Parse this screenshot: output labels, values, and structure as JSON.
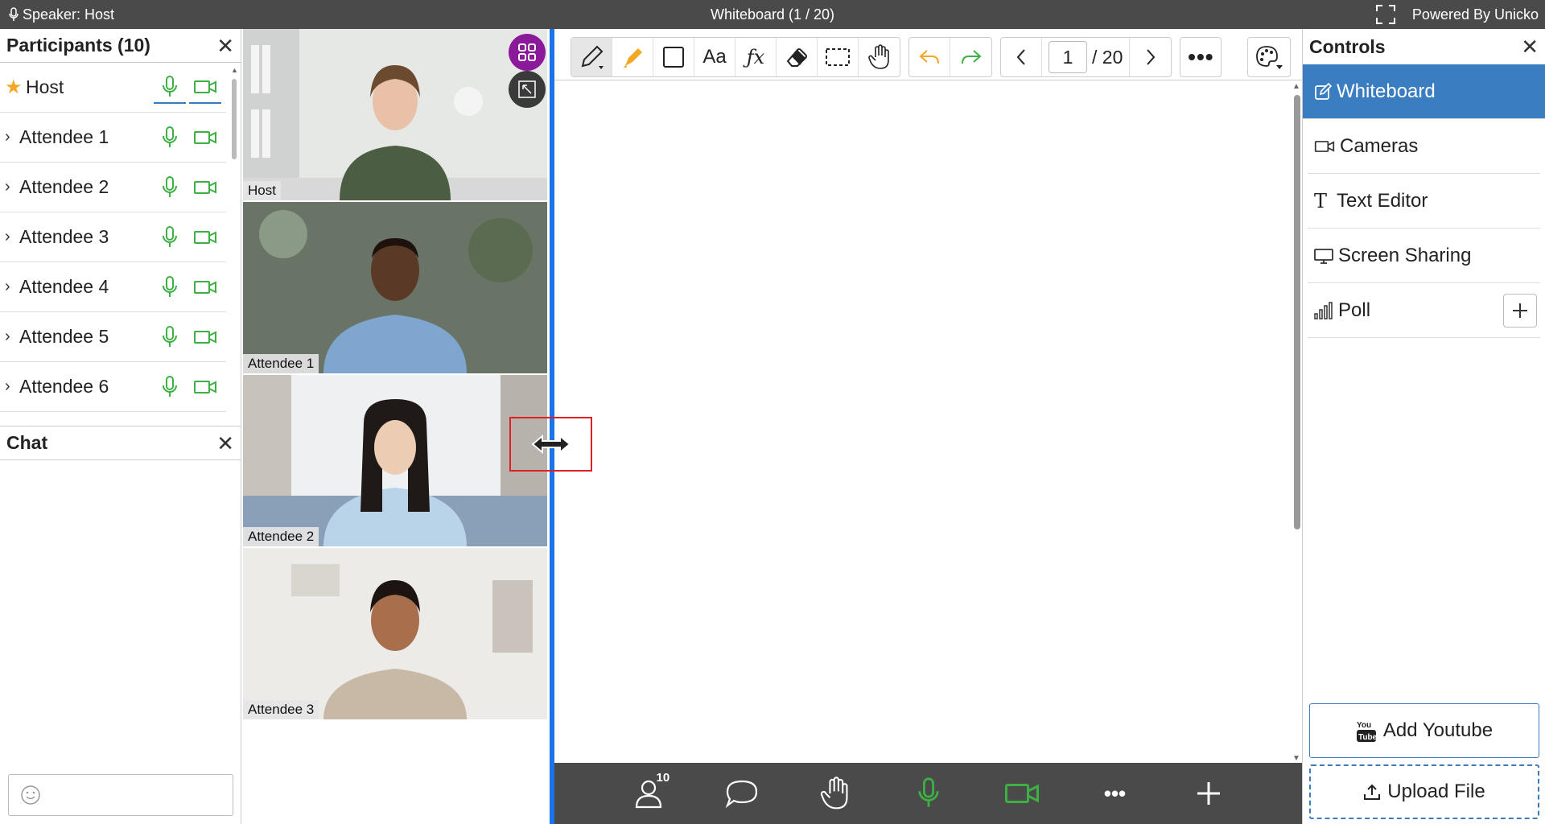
{
  "topbar": {
    "speaker": "Speaker: Host",
    "title": "Whiteboard (1 / 20)",
    "powered": "Powered By Unicko"
  },
  "participants": {
    "title": "Participants (10)",
    "items": [
      {
        "name": "Host"
      },
      {
        "name": "Attendee 1"
      },
      {
        "name": "Attendee 2"
      },
      {
        "name": "Attendee 3"
      },
      {
        "name": "Attendee 4"
      },
      {
        "name": "Attendee 5"
      },
      {
        "name": "Attendee 6"
      }
    ]
  },
  "chat": {
    "title": "Chat"
  },
  "videos": [
    {
      "label": "Host"
    },
    {
      "label": "Attendee 1"
    },
    {
      "label": "Attendee 2"
    },
    {
      "label": "Attendee 3"
    }
  ],
  "toolbar": {
    "text_tool": "Aa",
    "page_current": "1",
    "page_total": "/ 20"
  },
  "bottombar": {
    "participant_count": "10"
  },
  "controls": {
    "title": "Controls",
    "items": [
      {
        "label": "Whiteboard",
        "icon": "edit-icon"
      },
      {
        "label": "Cameras",
        "icon": "camera-icon"
      },
      {
        "label": "Text Editor",
        "icon": "text-icon"
      },
      {
        "label": "Screen Sharing",
        "icon": "monitor-icon"
      },
      {
        "label": "Poll",
        "icon": "bar-chart-icon"
      }
    ],
    "add_youtube": "Add Youtube",
    "upload_file": "Upload File"
  },
  "colors": {
    "accent": "#3a7dc0",
    "green": "#3cb043",
    "topbar": "#4a4a4a",
    "divider": "#1a73e8"
  }
}
